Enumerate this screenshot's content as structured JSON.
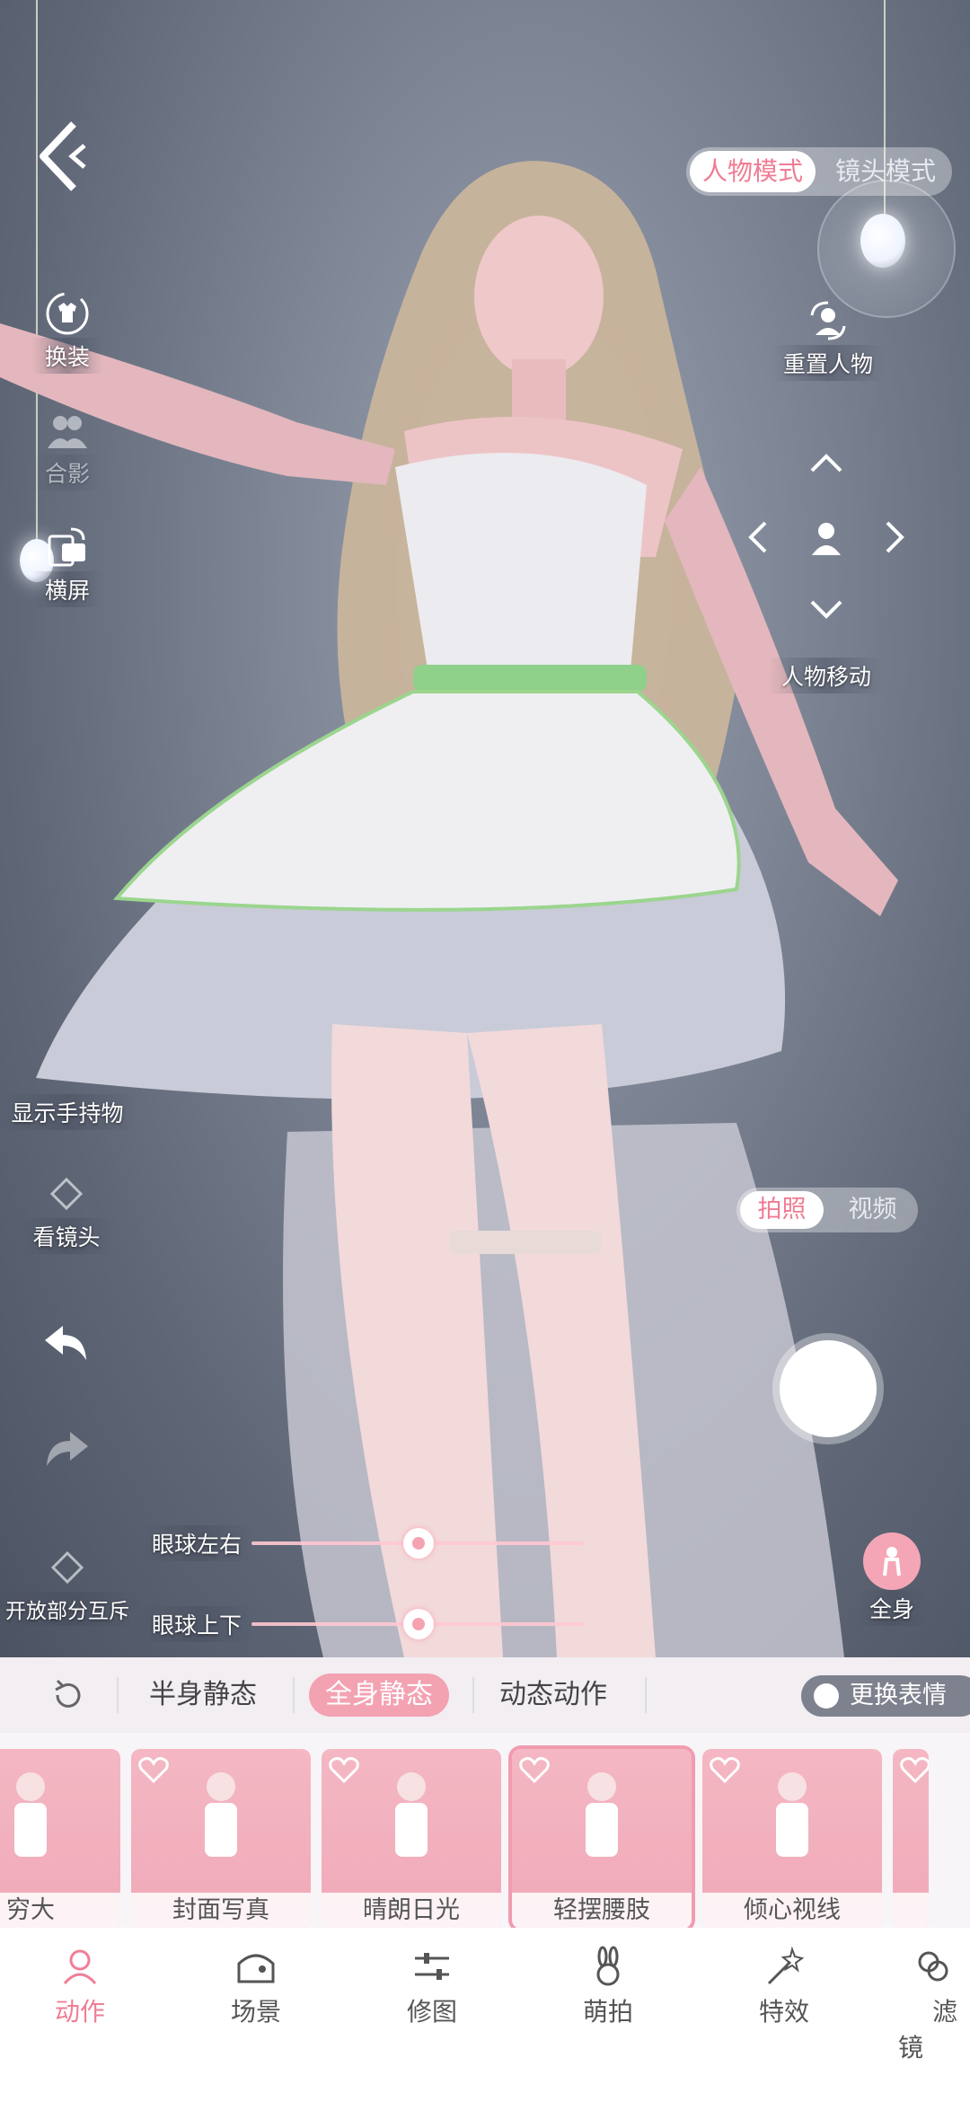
{
  "mode_toggle": {
    "character_mode": "人物模式",
    "camera_mode": "镜头模式"
  },
  "left_tools": {
    "outfit": "换装",
    "group_photo": "合影",
    "landscape": "横屏",
    "show_handheld": "显示手持物",
    "look_at_camera": "看镜头",
    "partial_exclusive": "开放部分互斥"
  },
  "right_tools": {
    "reset_character": "重置人物",
    "move_character": "人物移动",
    "full_body": "全身"
  },
  "capture_toggle": {
    "photo": "拍照",
    "video": "视频"
  },
  "sliders": [
    {
      "label": "眼球左右",
      "value": 0.5
    },
    {
      "label": "眼球上下",
      "value": 0.5
    }
  ],
  "pose_tabs": {
    "half_static": "半身静态",
    "full_static": "全身静态",
    "dynamic": "动态动作",
    "change_expression": "更换表情"
  },
  "pose_cards": [
    "穷大",
    "封面写真",
    "晴朗日光",
    "轻摆腰肢",
    "倾心视线",
    ""
  ],
  "bottom_nav": [
    "动作",
    "场景",
    "修图",
    "萌拍",
    "特效",
    "滤镜"
  ],
  "colors": {
    "accent": "#ef7e96",
    "card_bg": "#f0a9b8"
  }
}
